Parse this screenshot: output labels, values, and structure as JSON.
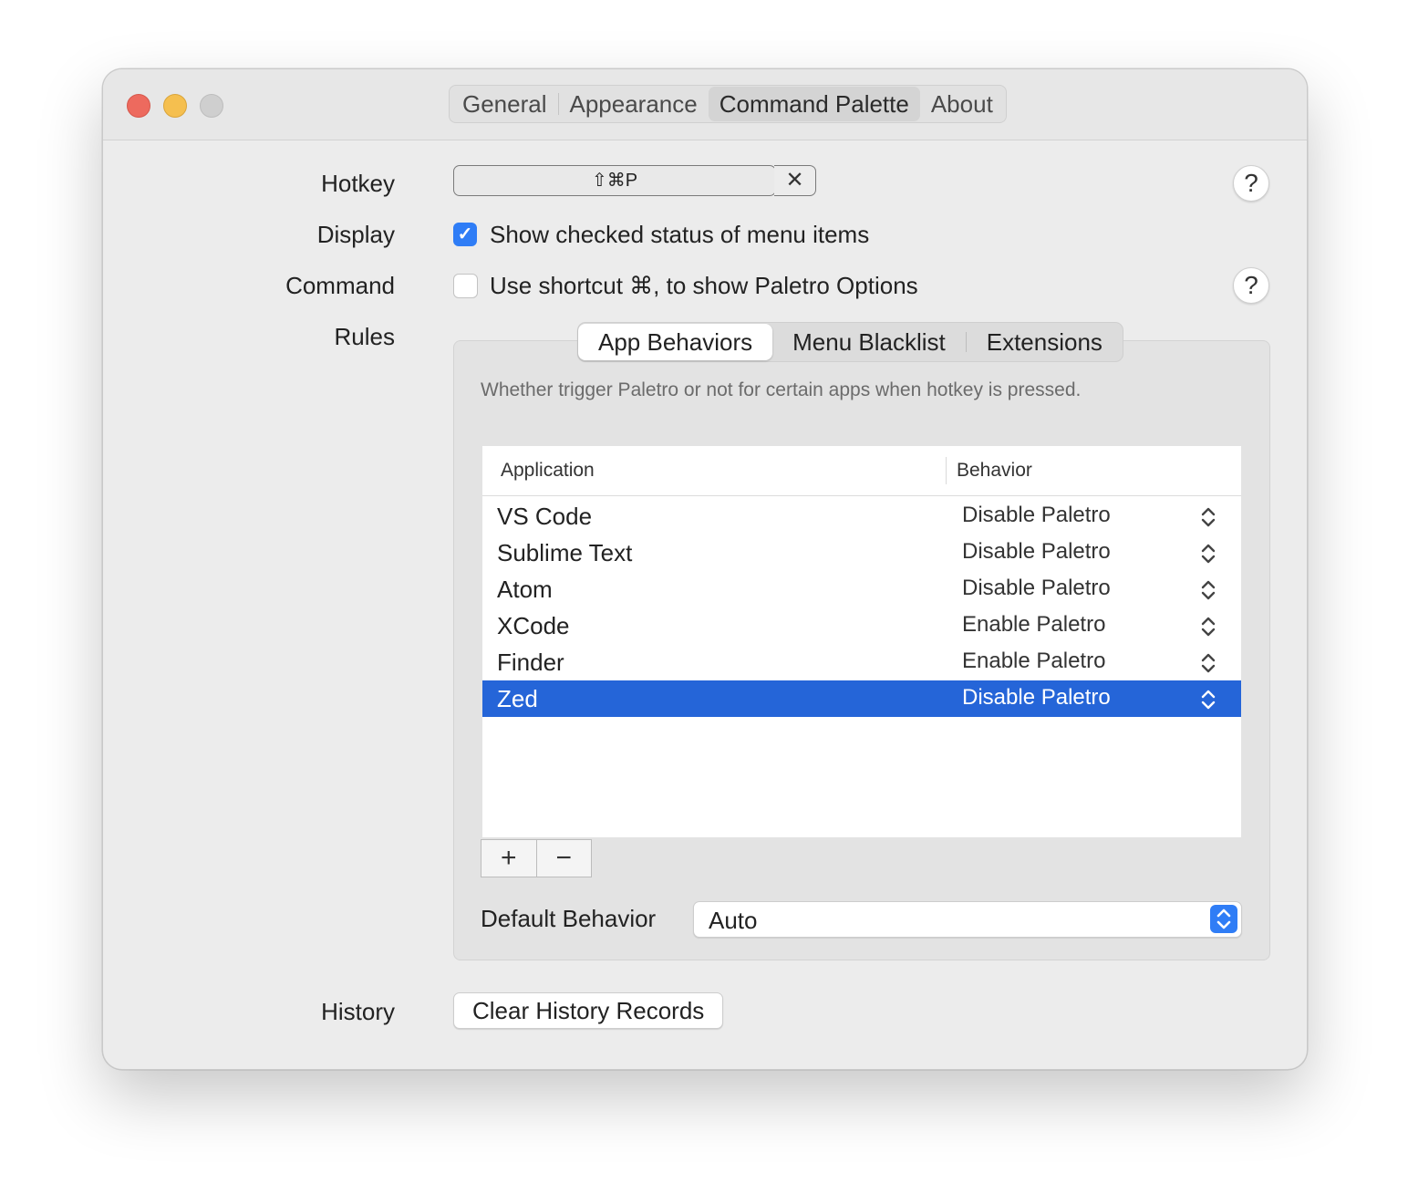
{
  "toolbar": {
    "tabs": [
      {
        "label": "General"
      },
      {
        "label": "Appearance"
      },
      {
        "label": "Command Palette"
      },
      {
        "label": "About"
      }
    ]
  },
  "settings": {
    "hotkey_label": "Hotkey",
    "hotkey_value": "⇧⌘P",
    "hotkey_clear": "✕",
    "display_label": "Display",
    "display_option": "Show checked status of menu items",
    "display_checked": true,
    "command_label": "Command",
    "command_option": "Use shortcut ⌘, to show Paletro Options",
    "command_checked": false,
    "rules_label": "Rules",
    "history_label": "History",
    "help_glyph": "?"
  },
  "rules": {
    "tabs": [
      {
        "label": "App Behaviors"
      },
      {
        "label": "Menu Blacklist"
      },
      {
        "label": "Extensions"
      }
    ],
    "description": "Whether trigger Paletro or not for certain apps when hotkey is pressed.",
    "columns": {
      "application": "Application",
      "behavior": "Behavior"
    },
    "rows": [
      {
        "app": "VS Code",
        "behavior": "Disable Paletro"
      },
      {
        "app": "Sublime Text",
        "behavior": "Disable Paletro"
      },
      {
        "app": "Atom",
        "behavior": "Disable Paletro"
      },
      {
        "app": "XCode",
        "behavior": "Enable Paletro"
      },
      {
        "app": "Finder",
        "behavior": "Enable Paletro"
      },
      {
        "app": "Zed",
        "behavior": "Disable Paletro",
        "selected": true
      }
    ],
    "add_label": "+",
    "remove_label": "−",
    "default_behavior_label": "Default Behavior",
    "default_behavior_value": "Auto"
  },
  "history": {
    "clear_button": "Clear History Records"
  },
  "colors": {
    "accent": "#2f7df6",
    "selection": "#2565d8",
    "close": "#ed6a5e",
    "minimize": "#f5bf4f"
  }
}
